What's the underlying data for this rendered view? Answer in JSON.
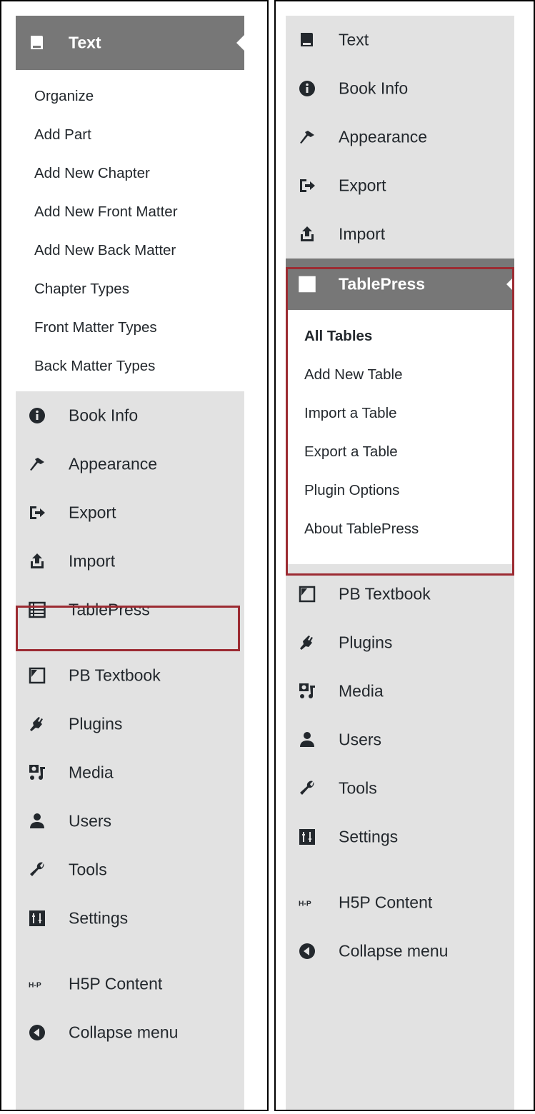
{
  "accent": "#9c2b32",
  "left_panel": {
    "current": {
      "label": "Text",
      "icon": "book-icon"
    },
    "submenu": [
      "Organize",
      "Add Part",
      "Add New Chapter",
      "Add New Front Matter",
      "Add New Back Matter",
      "Chapter Types",
      "Front Matter Types",
      "Back Matter Types"
    ],
    "items": [
      {
        "label": "Book Info",
        "icon": "info-icon"
      },
      {
        "label": "Appearance",
        "icon": "paintbrush-icon"
      },
      {
        "label": "Export",
        "icon": "export-icon"
      },
      {
        "label": "Import",
        "icon": "import-icon"
      },
      {
        "label": "TablePress",
        "icon": "table-icon"
      },
      {
        "label": "PB Textbook",
        "icon": "textbook-icon"
      },
      {
        "label": "Plugins",
        "icon": "plug-icon"
      },
      {
        "label": "Media",
        "icon": "media-icon"
      },
      {
        "label": "Users",
        "icon": "user-icon"
      },
      {
        "label": "Tools",
        "icon": "wrench-icon"
      },
      {
        "label": "Settings",
        "icon": "settings-icon"
      },
      {
        "label": "H5P Content",
        "icon": "h5p-icon"
      },
      {
        "label": "Collapse menu",
        "icon": "collapse-icon"
      }
    ]
  },
  "right_panel": {
    "items_top": [
      {
        "label": "Text",
        "icon": "book-icon"
      },
      {
        "label": "Book Info",
        "icon": "info-icon"
      },
      {
        "label": "Appearance",
        "icon": "paintbrush-icon"
      },
      {
        "label": "Export",
        "icon": "export-icon"
      },
      {
        "label": "Import",
        "icon": "import-icon"
      }
    ],
    "current": {
      "label": "TablePress",
      "icon": "table-icon"
    },
    "submenu": [
      "All Tables",
      "Add New Table",
      "Import a Table",
      "Export a Table",
      "Plugin Options",
      "About TablePress"
    ],
    "items_bottom": [
      {
        "label": "PB Textbook",
        "icon": "textbook-icon"
      },
      {
        "label": "Plugins",
        "icon": "plug-icon"
      },
      {
        "label": "Media",
        "icon": "media-icon"
      },
      {
        "label": "Users",
        "icon": "user-icon"
      },
      {
        "label": "Tools",
        "icon": "wrench-icon"
      },
      {
        "label": "Settings",
        "icon": "settings-icon"
      },
      {
        "label": "H5P Content",
        "icon": "h5p-icon"
      },
      {
        "label": "Collapse menu",
        "icon": "collapse-icon"
      }
    ]
  }
}
